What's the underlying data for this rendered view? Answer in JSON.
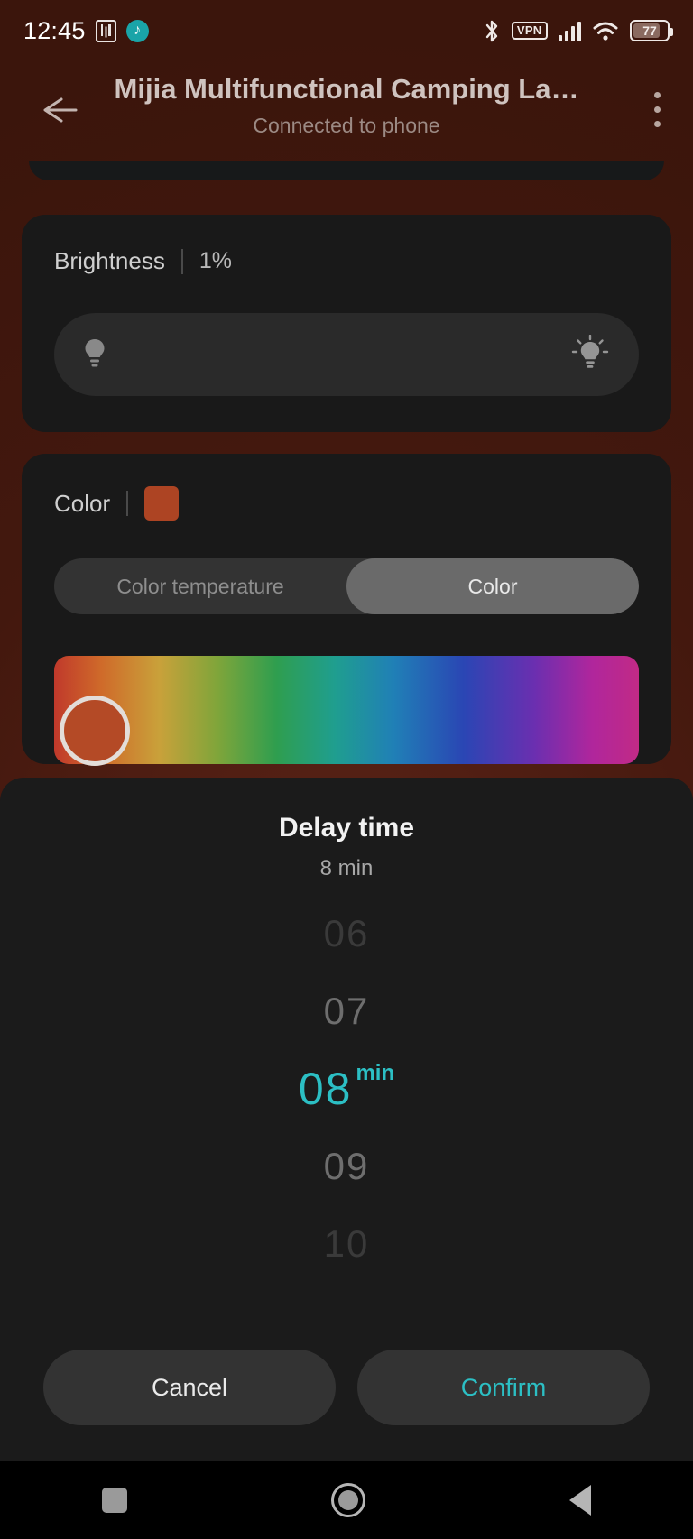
{
  "status_bar": {
    "clock": "12:45",
    "nfc_icon": "nfc-icon",
    "assistant_icon": "assistant-badge-icon",
    "bluetooth_icon": "bluetooth-icon",
    "vpn_label": "VPN",
    "signal_icon": "cellular-signal-icon",
    "wifi_icon": "wifi-icon",
    "battery_level": "77"
  },
  "app_bar": {
    "back_icon": "back-arrow-icon",
    "title": "Mijia Multifunctional Camping La…",
    "subtitle": "Connected to phone",
    "overflow_icon": "overflow-menu-icon"
  },
  "brightness": {
    "label": "Brightness",
    "value": "1%",
    "low_icon": "bulb-dim-icon",
    "high_icon": "bulb-bright-icon"
  },
  "color": {
    "label": "Color",
    "swatch_hex": "#ad4423",
    "tabs": [
      {
        "label": "Color temperature",
        "selected": false
      },
      {
        "label": "Color",
        "selected": true
      }
    ],
    "handle_hex": "#b44a26"
  },
  "sheet": {
    "title": "Delay time",
    "subtitle": "8 min",
    "unit": "min",
    "options": [
      "06",
      "07",
      "08",
      "09",
      "10"
    ],
    "selected_value": "08",
    "accent_hex": "#2cbfc4",
    "cancel_label": "Cancel",
    "confirm_label": "Confirm"
  },
  "nav_bar": {
    "recents_icon": "recents-square-icon",
    "home_icon": "home-circle-icon",
    "back_icon": "back-triangle-icon"
  }
}
